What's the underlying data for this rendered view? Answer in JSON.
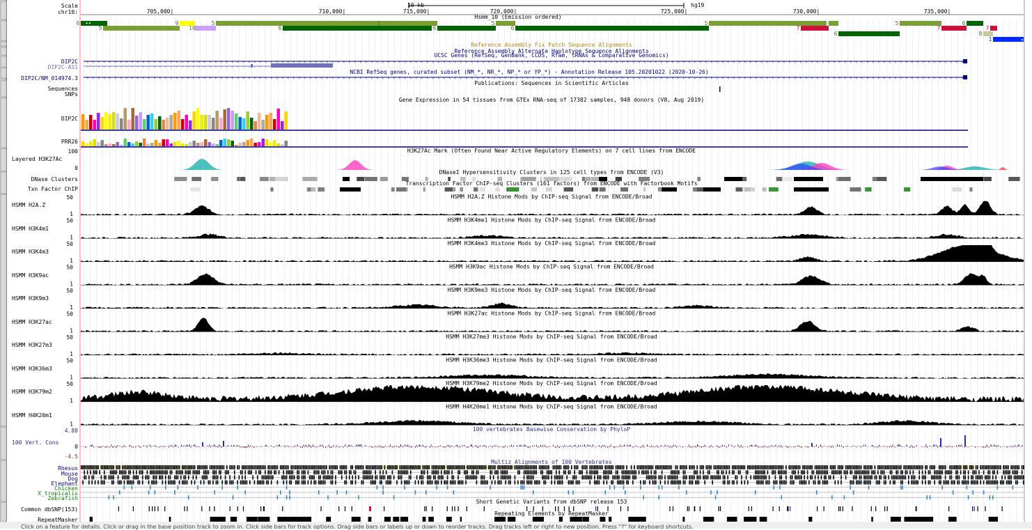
{
  "colors": {
    "gene": "#000080",
    "conservation": "#2a2a8a",
    "highlight_magenta": "#e000e0",
    "guide_line": "#aab4ff"
  },
  "ruler": {
    "scale_label": "Scale",
    "chrom_label": "chr10:",
    "scale_text": "10 kb",
    "assembly": "hg19",
    "ticks": [
      {
        "label": "705,000|"
      },
      {
        "label": "710,000|"
      },
      {
        "label": "715,000|"
      },
      {
        "label": "720,000|"
      },
      {
        "label": "725,000|"
      },
      {
        "label": "730,000|"
      },
      {
        "label": "735,000|"
      }
    ]
  },
  "chromhmm": {
    "title": "Hsmm_10 (Emission ordered)",
    "blocks": [
      {
        "state": "6"
      },
      {
        "state": "5"
      },
      {
        "state": "9"
      },
      {
        "state": "10"
      },
      {
        "state": "5"
      },
      {
        "state": "6"
      },
      {
        "state": "5"
      },
      {
        "state": "6"
      },
      {
        "state": "5"
      },
      {
        "state": "6"
      },
      {
        "state": "5"
      },
      {
        "state": "7"
      },
      {
        "state": "5"
      },
      {
        "state": "6"
      },
      {
        "state": "5"
      },
      {
        "state": "7"
      },
      {
        "state": "6"
      },
      {
        "state": "8"
      },
      {
        "state": "7"
      },
      {
        "state": "1"
      }
    ]
  },
  "tracks": {
    "fix_patch": "Reference Assembly Fix Patch Sequence Alignments",
    "alt_haplo": "Reference Assembly Alternate Haplotype Sequence Alignments",
    "ucsc_genes": "UCSC Genes (RefSeq, GenBank, CCDS, Rfam, tRNAs & Comparative Genomics)",
    "gene_dip2c": "DIP2C",
    "gene_dip2c_as1": "DIP2C-AS1",
    "ncbi_refseq": "NCBI RefSeq genes, curated subset (NM_*, NR_*, NP_* or YP_*) - Annotation Release 105.20201022 (2020-10-26)",
    "refseq_transcript": "DIP2C/NM_014974.3",
    "publications": "Publications: Sequences in Scientific Articles",
    "sequences_label": "Sequences",
    "snps_label": "SNPs",
    "gtex": "Gene Expression in 54 tissues from GTEx RNA-seq of 17382 samples, 948 donors (V8, Aug 2019)",
    "gtex_gene1": "DIP2C",
    "gtex_gene2": "PRR26",
    "h3k27ac": "H3K27Ac Mark (Often Found Near Active Regulatory Elements) on 7 cell lines from ENCODE",
    "layered_label": "Layered H3K27Ac",
    "layered_max": "100",
    "layered_min": "0",
    "dnase": "DNaseI Hypersensitivity Clusters in 125 cell types from ENCODE (V3)",
    "dnase_label": "DNase Clusters",
    "tfbs": "Transcription Factor ChIP-seq Clusters (161 factors) from ENCODE with Factorbook Motifs",
    "tfbs_label": "Txn Factor ChIP"
  },
  "histone_tracks": [
    {
      "label": "HSMM H2A.Z",
      "title": "HSMM H2A.Z Histone Mods by ChIP-seq Signal from ENCODE/Broad",
      "max": "50",
      "min": "1"
    },
    {
      "label": "HSMM H3K4m1",
      "title": "HSMM H3K4me1 Histone Mods by ChIP-seq Signal from ENCODE/Broad",
      "max": "50",
      "min": "1"
    },
    {
      "label": "HSMM H3K4m3",
      "title": "HSMM H3K4me3 Histone Mods by ChIP-seq Signal from ENCODE/Broad",
      "max": "50",
      "min": "1"
    },
    {
      "label": "HSMM H3K9ac",
      "title": "HSMM H3K9ac Histone Mods by ChIP-seq Signal from ENCODE/Broad",
      "max": "50",
      "min": "1"
    },
    {
      "label": "HSMM H3K9m3",
      "title": "HSMM H3K9me3 Histone Mods by ChIP-seq Signal from ENCODE/Broad",
      "max": "50",
      "min": "1"
    },
    {
      "label": "HSMM H3K27ac",
      "title": "HSMM H3K27ac Histone Mods by ChIP-seq Signal from ENCODE/Broad",
      "max": "50",
      "min": "1"
    },
    {
      "label": "HSMM H3K27m3",
      "title": "HSMM H3K27me3 Histone Mods by ChIP-seq Signal from ENCODE/Broad",
      "max": "50",
      "min": "1"
    },
    {
      "label": "HSMM H3K36m3",
      "title": "HSMM H3K36me3 Histone Mods by ChIP-seq Signal from ENCODE/Broad",
      "max": "50",
      "min": "1"
    },
    {
      "label": "HSMM H3K79m2",
      "title": "HSMM H3K79me2 Histone Mods by ChIP-seq Signal from ENCODE/Broad",
      "max": "50",
      "min": "1"
    },
    {
      "label": "HSMM H4K20m1",
      "title": "HSMM H4K20me1 Histone Mods by ChIP-seq Signal from ENCODE/Broad",
      "max": "",
      "min": "1"
    }
  ],
  "conservation": {
    "title": "100 vertebrates Basewise Conservation by PhyloP",
    "label": "100 Vert. Cons",
    "max": "4.88",
    "zero": "0",
    "min": "-4.5"
  },
  "multiz": {
    "title": "Multiz Alignments of 100 Vertebrates",
    "species": [
      "Rhesus",
      "Mouse",
      "Dog",
      "Elephant",
      "Chicken",
      "X_tropicalis",
      "Zebrafish"
    ]
  },
  "dbsnp": {
    "title": "Short Genetic Variants from dbSNP release 153",
    "label": "Common dbSNP(153)"
  },
  "repeatmasker": {
    "title": "Repeating Elements by RepeatMasker",
    "label": "RepeatMasker"
  },
  "footer": {
    "text": "Click on a feature for details. Click or drag in the base position track to zoom in. Click side bars for track options. Drag side bars or labels up or down to reorder tracks. Drag tracks left or right to new position. Press \"?\" for keyboard shortcuts."
  }
}
